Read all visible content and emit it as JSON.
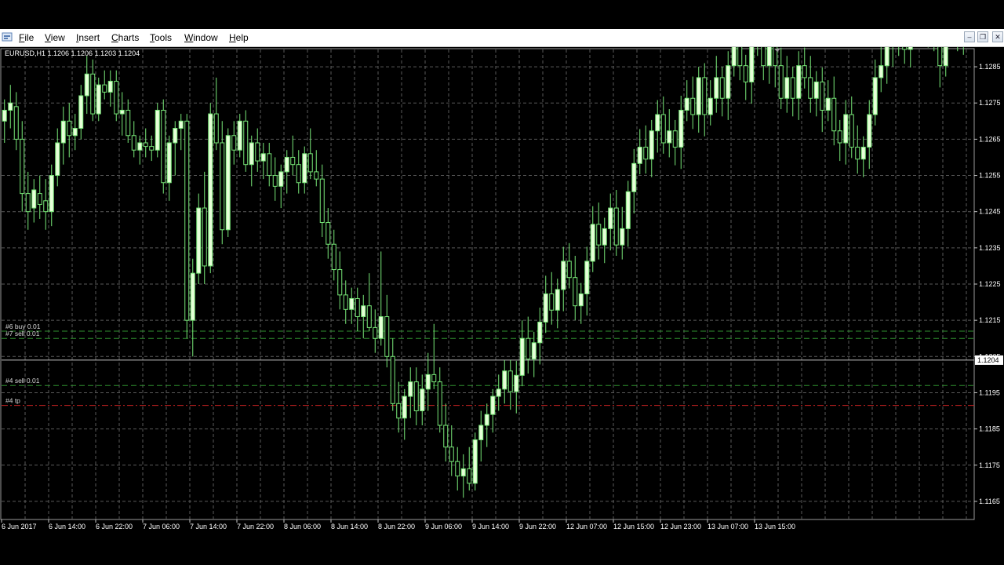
{
  "menu": {
    "items": [
      {
        "label": "File"
      },
      {
        "label": "View"
      },
      {
        "label": "Insert"
      },
      {
        "label": "Charts"
      },
      {
        "label": "Tools"
      },
      {
        "label": "Window"
      },
      {
        "label": "Help"
      }
    ]
  },
  "window_controls": {
    "minimize": "–",
    "restore": "❐",
    "close": "✕"
  },
  "chart_info": "EURUSD,H1  1.1206 1.1206 1.1203 1.1204",
  "colors": {
    "background": "#000000",
    "grid": "#5a5a5a",
    "candle": "#78e878",
    "candle_body_fill": "#e6ffd8",
    "order_line": "#2f8f2f",
    "tp_line": "#cc2222",
    "bid_line": "#c0c0c0",
    "text": "#ffffff"
  },
  "chart_data": {
    "type": "candlestick",
    "symbol": "EURUSD",
    "timeframe": "H1",
    "ohlc_header": {
      "open": 1.1206,
      "high": 1.1206,
      "low": 1.1203,
      "close": 1.1204
    },
    "current_price": "1.1204",
    "ylim": [
      1.116,
      1.129
    ],
    "y_ticks": [
      "1.1285",
      "1.1275",
      "1.1265",
      "1.1255",
      "1.1245",
      "1.1235",
      "1.1225",
      "1.1215",
      "1.1205",
      "1.1195",
      "1.1185",
      "1.1175",
      "1.1165"
    ],
    "x_ticks": [
      "6 Jun 2017",
      "6 Jun 14:00",
      "6 Jun 22:00",
      "7 Jun 06:00",
      "7 Jun 14:00",
      "7 Jun 22:00",
      "8 Jun 06:00",
      "8 Jun 14:00",
      "8 Jun 22:00",
      "9 Jun 06:00",
      "9 Jun 14:00",
      "9 Jun 22:00",
      "12 Jun 07:00",
      "12 Jun 15:00",
      "12 Jun 23:00",
      "13 Jun 07:00",
      "13 Jun 15:00"
    ],
    "bars_per_tick": 8,
    "grid": true,
    "order_lines": [
      {
        "label": "#6 buy 0.01",
        "price": 1.1212,
        "style": "dashed",
        "color": "#2f8f2f"
      },
      {
        "label": "#7 sell 0.01",
        "price": 1.121,
        "style": "dashed",
        "color": "#2f8f2f"
      },
      {
        "label": "#4 sell 0.01",
        "price": 1.1197,
        "style": "dashed",
        "color": "#2f8f2f"
      },
      {
        "label": "#4 tp",
        "price": 1.11915,
        "style": "dashdot",
        "color": "#cc2222"
      }
    ],
    "trade_markers": [
      {
        "bar": 176,
        "price": 1.1207,
        "color": "blue"
      },
      {
        "bar": 177,
        "price": 1.1205,
        "color": "red"
      },
      {
        "bar": 195,
        "price": 1.1222,
        "color": "red"
      },
      {
        "bar": 210,
        "price": 1.12,
        "color": "red"
      },
      {
        "bar": 211,
        "price": 1.1202,
        "color": "orange"
      },
      {
        "bar": 232,
        "price": 1.1191,
        "color": "blue"
      },
      {
        "bar": 243,
        "price": 1.1214,
        "color": "blue"
      },
      {
        "bar": 244,
        "price": 1.1211,
        "color": "red"
      }
    ],
    "trade_paths": [
      {
        "from": [
          176,
          1.1207
        ],
        "to": [
          244,
          1.1211
        ],
        "color": "#2038c0"
      },
      {
        "from": [
          177,
          1.1205
        ],
        "to": [
          211,
          1.1201
        ],
        "color": "#b02020"
      }
    ],
    "candles": [
      [
        1.127,
        1.1276,
        1.1264,
        1.1273
      ],
      [
        1.1273,
        1.128,
        1.1268,
        1.1275
      ],
      [
        1.1274,
        1.1278,
        1.1262,
        1.1265
      ],
      [
        1.1265,
        1.127,
        1.1245,
        1.125
      ],
      [
        1.125,
        1.1256,
        1.124,
        1.1245
      ],
      [
        1.1246,
        1.1254,
        1.1242,
        1.1251
      ],
      [
        1.125,
        1.1255,
        1.1243,
        1.1247
      ],
      [
        1.1248,
        1.1254,
        1.124,
        1.1245
      ],
      [
        1.1245,
        1.1258,
        1.1241,
        1.1255
      ],
      [
        1.1255,
        1.1268,
        1.1252,
        1.1264
      ],
      [
        1.1264,
        1.1274,
        1.1258,
        1.127
      ],
      [
        1.127,
        1.1275,
        1.126,
        1.1266
      ],
      [
        1.1266,
        1.1272,
        1.1262,
        1.1268
      ],
      [
        1.1268,
        1.128,
        1.1265,
        1.1277
      ],
      [
        1.1277,
        1.1288,
        1.1272,
        1.1283
      ],
      [
        1.1283,
        1.1287,
        1.127,
        1.1272
      ],
      [
        1.1272,
        1.1282,
        1.127,
        1.128
      ],
      [
        1.128,
        1.1284,
        1.1276,
        1.1278
      ],
      [
        1.1278,
        1.1284,
        1.1274,
        1.1281
      ],
      [
        1.1281,
        1.1284,
        1.127,
        1.1272
      ],
      [
        1.1272,
        1.1278,
        1.1266,
        1.1273
      ],
      [
        1.1273,
        1.1276,
        1.1264,
        1.1266
      ],
      [
        1.1266,
        1.127,
        1.126,
        1.1262
      ],
      [
        1.1262,
        1.1266,
        1.1258,
        1.1264
      ],
      [
        1.1264,
        1.1268,
        1.126,
        1.1263
      ],
      [
        1.1263,
        1.1266,
        1.1259,
        1.1262
      ],
      [
        1.1262,
        1.1275,
        1.126,
        1.1273
      ],
      [
        1.1273,
        1.1276,
        1.125,
        1.1253
      ],
      [
        1.1253,
        1.1266,
        1.1248,
        1.1264
      ],
      [
        1.1264,
        1.127,
        1.1255,
        1.1268
      ],
      [
        1.1268,
        1.1272,
        1.1262,
        1.127
      ],
      [
        1.127,
        1.1272,
        1.121,
        1.1215
      ],
      [
        1.1215,
        1.1232,
        1.1205,
        1.1228
      ],
      [
        1.1228,
        1.125,
        1.1225,
        1.1246
      ],
      [
        1.1246,
        1.1256,
        1.1225,
        1.123
      ],
      [
        1.123,
        1.1275,
        1.1228,
        1.1272
      ],
      [
        1.1272,
        1.1282,
        1.1262,
        1.1264
      ],
      [
        1.1264,
        1.127,
        1.1236,
        1.124
      ],
      [
        1.124,
        1.1268,
        1.1238,
        1.1266
      ],
      [
        1.1266,
        1.127,
        1.1258,
        1.1262
      ],
      [
        1.1262,
        1.1272,
        1.126,
        1.127
      ],
      [
        1.127,
        1.1273,
        1.1256,
        1.1258
      ],
      [
        1.1258,
        1.1266,
        1.1252,
        1.1264
      ],
      [
        1.1264,
        1.1268,
        1.1256,
        1.1259
      ],
      [
        1.1259,
        1.1264,
        1.1254,
        1.1261
      ],
      [
        1.1261,
        1.1264,
        1.1252,
        1.1255
      ],
      [
        1.1255,
        1.126,
        1.1248,
        1.1252
      ],
      [
        1.1252,
        1.1258,
        1.1246,
        1.1256
      ],
      [
        1.1256,
        1.1262,
        1.125,
        1.126
      ],
      [
        1.126,
        1.1266,
        1.1255,
        1.1258
      ],
      [
        1.1258,
        1.1262,
        1.125,
        1.1253
      ],
      [
        1.1253,
        1.1263,
        1.125,
        1.1261
      ],
      [
        1.1261,
        1.1268,
        1.1254,
        1.1256
      ],
      [
        1.1256,
        1.1262,
        1.1252,
        1.1254
      ],
      [
        1.1254,
        1.1258,
        1.1238,
        1.1242
      ],
      [
        1.1242,
        1.1246,
        1.1232,
        1.1236
      ],
      [
        1.1236,
        1.124,
        1.1226,
        1.1229
      ],
      [
        1.1229,
        1.1234,
        1.1218,
        1.1222
      ],
      [
        1.1222,
        1.1226,
        1.1214,
        1.1218
      ],
      [
        1.1218,
        1.1224,
        1.1214,
        1.1221
      ],
      [
        1.1221,
        1.1224,
        1.1212,
        1.1216
      ],
      [
        1.1216,
        1.1222,
        1.121,
        1.1219
      ],
      [
        1.1219,
        1.1228,
        1.1212,
        1.1213
      ],
      [
        1.1213,
        1.1218,
        1.1206,
        1.121
      ],
      [
        1.121,
        1.1234,
        1.1208,
        1.1216
      ],
      [
        1.1216,
        1.1222,
        1.1202,
        1.1205
      ],
      [
        1.1205,
        1.121,
        1.119,
        1.1192
      ],
      [
        1.1192,
        1.1198,
        1.1184,
        1.1188
      ],
      [
        1.1188,
        1.1196,
        1.1182,
        1.1194
      ],
      [
        1.1194,
        1.1202,
        1.1188,
        1.1198
      ],
      [
        1.1198,
        1.1202,
        1.1186,
        1.119
      ],
      [
        1.119,
        1.12,
        1.1186,
        1.1196
      ],
      [
        1.1196,
        1.1206,
        1.119,
        1.12
      ],
      [
        1.12,
        1.1214,
        1.1196,
        1.1198
      ],
      [
        1.1198,
        1.1202,
        1.1184,
        1.1186
      ],
      [
        1.1186,
        1.1192,
        1.1176,
        1.118
      ],
      [
        1.118,
        1.1186,
        1.1172,
        1.1176
      ],
      [
        1.1176,
        1.118,
        1.1168,
        1.1172
      ],
      [
        1.1172,
        1.1178,
        1.1166,
        1.1174
      ],
      [
        1.1174,
        1.118,
        1.1168,
        1.117
      ],
      [
        1.117,
        1.1184,
        1.1168,
        1.1182
      ],
      [
        1.1182,
        1.119,
        1.1176,
        1.1186
      ],
      [
        1.1186,
        1.1192,
        1.118,
        1.1189
      ],
      [
        1.1189,
        1.1196,
        1.1184,
        1.1194
      ],
      [
        1.1194,
        1.12,
        1.119,
        1.1196
      ],
      [
        1.1196,
        1.1204,
        1.1192,
        1.1201
      ]
    ]
  }
}
